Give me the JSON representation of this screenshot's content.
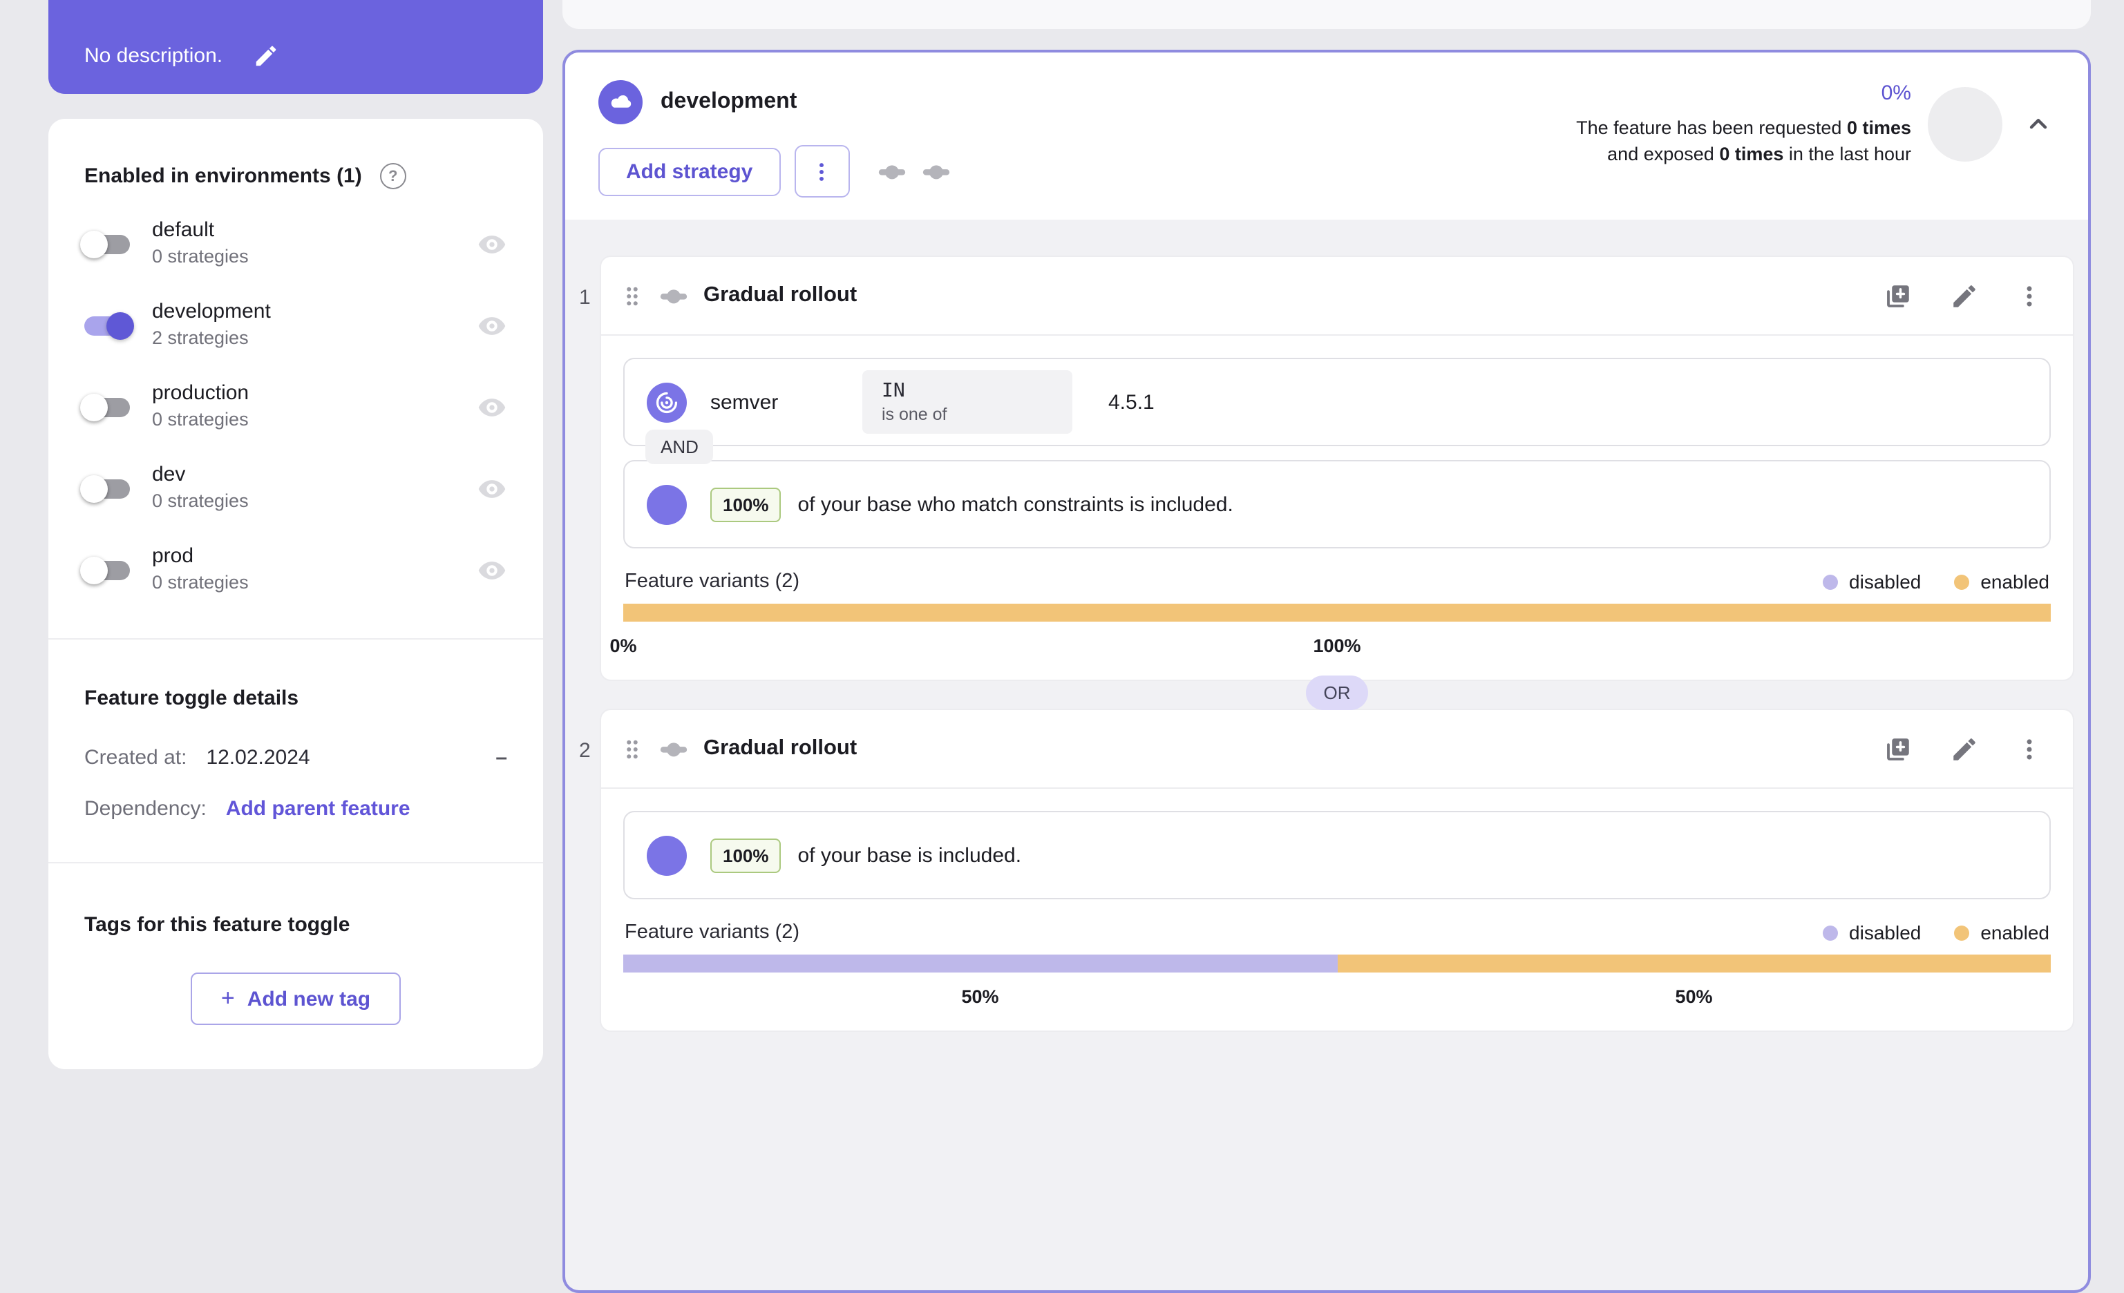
{
  "sidebar": {
    "description": {
      "text": "No description."
    },
    "environments": {
      "title": "Enabled in environments (1)",
      "help_glyph": "?",
      "items": [
        {
          "name": "default",
          "strategies": "0 strategies",
          "enabled": false
        },
        {
          "name": "development",
          "strategies": "2 strategies",
          "enabled": true
        },
        {
          "name": "production",
          "strategies": "0 strategies",
          "enabled": false
        },
        {
          "name": "dev",
          "strategies": "0 strategies",
          "enabled": false
        },
        {
          "name": "prod",
          "strategies": "0 strategies",
          "enabled": false
        }
      ]
    },
    "details": {
      "title": "Feature toggle details",
      "created_label": "Created at:",
      "created_value": "12.02.2024",
      "collapse_glyph": "–",
      "dependency_label": "Dependency:",
      "dependency_link": "Add parent feature"
    },
    "tags": {
      "title": "Tags for this feature toggle",
      "plus_glyph": "+",
      "add_label": "Add new tag"
    }
  },
  "main": {
    "header": {
      "environment": "development",
      "add_strategy": "Add strategy",
      "exposure": "0%",
      "line1_pre": "The feature has been requested ",
      "line1_bold": "0 times",
      "line2_pre": "and exposed ",
      "line2_bold": "0 times",
      "line2_post": " in the last hour"
    },
    "or_label": "OR",
    "strategies": [
      {
        "number": "1",
        "title": "Gradual rollout",
        "constraint": {
          "field": "semver",
          "operator": "IN",
          "operator_desc": "is one of",
          "value": "4.5.1",
          "connector": "AND"
        },
        "rollout": {
          "badge": "100%",
          "text": "of your base who match constraints is included."
        },
        "variants": {
          "label": "Feature variants (2)",
          "legend": [
            {
              "name": "disabled"
            },
            {
              "name": "enabled"
            }
          ],
          "segments": [
            {
              "name": "disabled",
              "percent": 0,
              "start": 0,
              "label": "0%",
              "mid": 0
            },
            {
              "name": "enabled",
              "percent": 100,
              "start": 0,
              "label": "100%",
              "mid": 50
            }
          ]
        }
      },
      {
        "number": "2",
        "title": "Gradual rollout",
        "rollout": {
          "badge": "100%",
          "text": "of your base is included."
        },
        "variants": {
          "label": "Feature variants (2)",
          "legend": [
            {
              "name": "disabled"
            },
            {
              "name": "enabled"
            }
          ],
          "segments": [
            {
              "name": "disabled",
              "percent": 50,
              "start": 0,
              "label": "50%",
              "mid": 25
            },
            {
              "name": "enabled",
              "percent": 50,
              "start": 50,
              "label": "50%",
              "mid": 75
            }
          ]
        }
      }
    ]
  },
  "colors": {
    "accent": "#6b63de",
    "link_purple": "#6155d8",
    "disabled_variant": "#beb8ea",
    "enabled_variant": "#f2c478",
    "card_border": "#8f8bdf"
  }
}
